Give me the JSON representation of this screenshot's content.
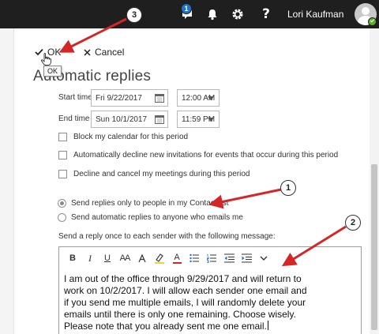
{
  "header": {
    "skype_badge": "1",
    "help_label": "?",
    "user_name": "Lori Kaufman"
  },
  "commands": {
    "ok_label": "OK",
    "cancel_label": "Cancel",
    "ok_tooltip": "OK"
  },
  "page": {
    "title": "Automatic replies"
  },
  "times": {
    "start_label": "Start time",
    "start_date": "Fri 9/22/2017",
    "start_time": "12:00 AM",
    "end_label": "End time",
    "end_date": "Sun 10/1/2017",
    "end_time": "11:59 PM"
  },
  "options": [
    "Block my calendar for this period",
    "Automatically decline new invitations for events that occur during this period",
    "Decline and cancel my meetings during this period"
  ],
  "recipients": {
    "contacts_only": "Send replies only to people in my Contact list",
    "everyone": "Send automatic replies to anyone who emails me",
    "selected": "contacts_only"
  },
  "message": {
    "label": "Send a reply once to each sender with the following message:",
    "toolbar": {
      "bold": "B",
      "italic": "I",
      "underline": "U",
      "font_size": "AA",
      "text_color": "A"
    },
    "lines": [
      "I am out of the office through 9/29/2017 and will return to",
      "work on 10/2/2017. I will allow each sender one email and",
      "if you send me multiple emails, I will randomly delete your",
      "emails until there is only one remaining. Choose wisely.",
      "Please note that you already sent me one email."
    ]
  },
  "annotations": {
    "step1": "1",
    "step2": "2",
    "step3": "3",
    "color": "#d42626"
  },
  "colors": {
    "topbar": "#1f1f1f",
    "badge": "#1e74c9",
    "presence": "#5db12a",
    "font_color_bar": "#d42626",
    "highlight_bar": "#f2d338"
  }
}
